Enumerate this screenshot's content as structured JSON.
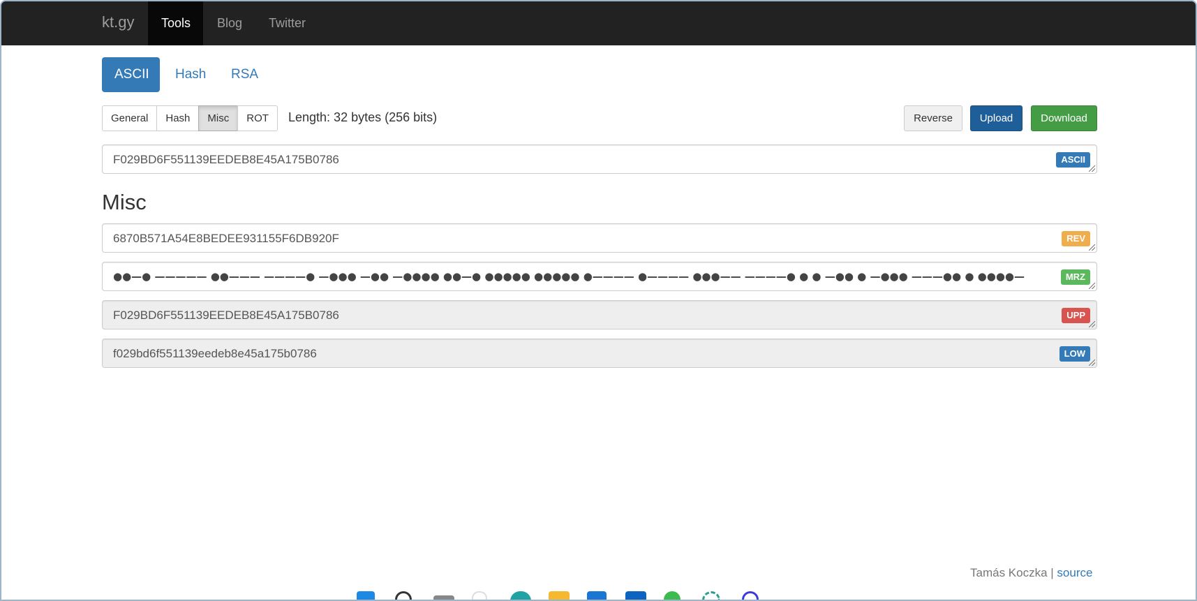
{
  "navbar": {
    "brand": "kt.gy",
    "items": [
      {
        "label": "Tools",
        "active": true
      },
      {
        "label": "Blog",
        "active": false
      },
      {
        "label": "Twitter",
        "active": false
      }
    ]
  },
  "tabs": [
    {
      "label": "ASCII",
      "active": true
    },
    {
      "label": "Hash",
      "active": false
    },
    {
      "label": "RSA",
      "active": false
    }
  ],
  "subtabs": [
    {
      "label": "General",
      "active": false
    },
    {
      "label": "Hash",
      "active": false
    },
    {
      "label": "Misc",
      "active": true
    },
    {
      "label": "ROT",
      "active": false
    }
  ],
  "length_text": "Length: 32 bytes (256 bits)",
  "buttons": {
    "reverse": "Reverse",
    "upload": "Upload",
    "download": "Download"
  },
  "input": {
    "value": "F029BD6F551139EEDEB8E45A175B0786",
    "badge": "ASCII"
  },
  "section_title": "Misc",
  "outputs": [
    {
      "value": "6870B571A54E8BEDEE931155F6DB920F",
      "badge": "REV",
      "badge_color": "#f0ad4e",
      "readonly": false
    },
    {
      "value": "●●—● ————— ●●——— ————● —●●● —●● —●●●● ●●—● ●●●●● ●●●●● ●———— ●———— ●●●—— ————● ● ● —●● ● —●●● ———●● ● ●●●●—",
      "badge": "MRZ",
      "badge_color": "#5cb85c",
      "readonly": false
    },
    {
      "value": "F029BD6F551139EEDEB8E45A175B0786",
      "badge": "UPP",
      "badge_color": "#d9534f",
      "readonly": true
    },
    {
      "value": "f029bd6f551139eedeb8e45a175b0786",
      "badge": "LOW",
      "badge_color": "#337ab7",
      "readonly": true
    }
  ],
  "footer": {
    "author": "Tamás Koczka",
    "separator": " | ",
    "link": "source"
  },
  "colors": {
    "navbar_bg": "#222222",
    "primary": "#337ab7",
    "success": "#449d44"
  }
}
